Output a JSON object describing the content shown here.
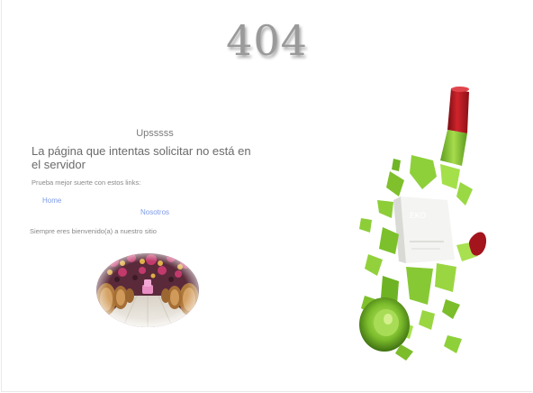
{
  "page": {
    "error_code": "404",
    "subtitle": "Upsssss",
    "message": "La página que intentas solicitar no está en el servidor",
    "hint": "Prueba mejor suerte con estos links:",
    "links": {
      "home": "Home",
      "about": "Nosotros"
    },
    "welcome": "Siempre eres bienvenido(a) a nuestro sitio"
  },
  "colors": {
    "link": "#7d9be8",
    "text": "#6a6a6a",
    "bottle_green": "#8fce3c",
    "cap_red": "#b71c1c"
  },
  "images": {
    "cellar": "wine-cellar-photo",
    "bottle": "shattered-wine-bottle"
  }
}
